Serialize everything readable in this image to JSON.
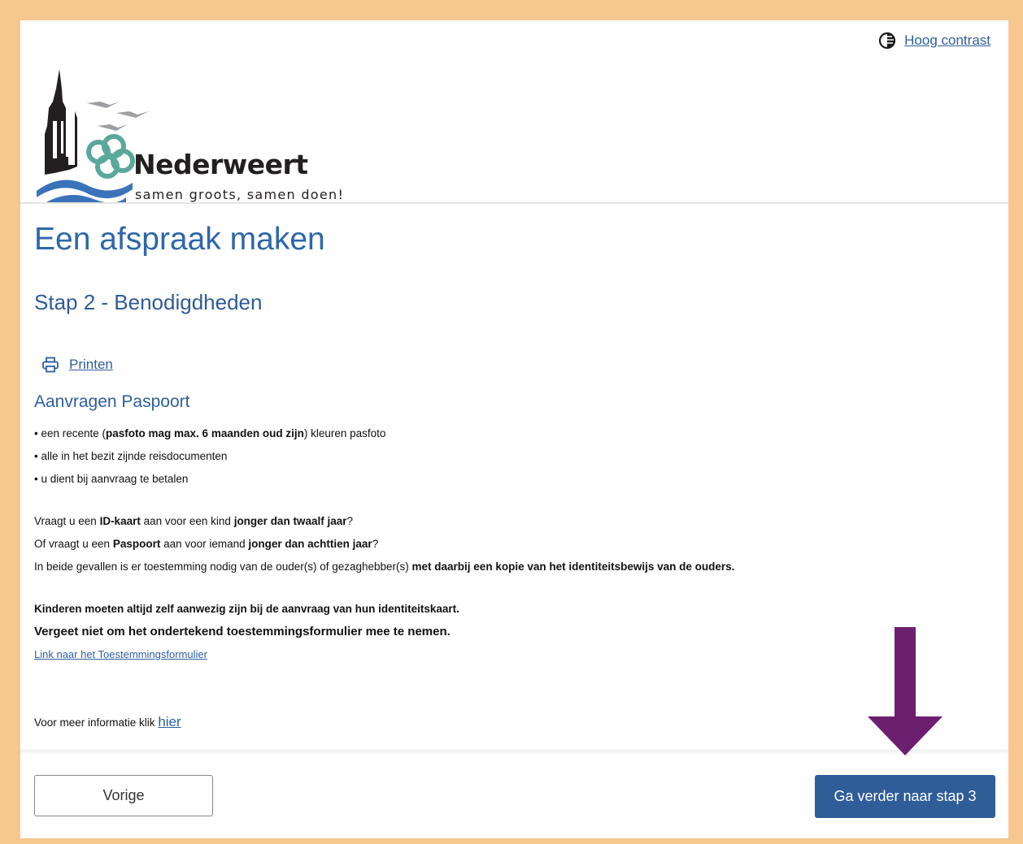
{
  "header": {
    "high_contrast_label": "Hoog contrast"
  },
  "logo": {
    "name": "Nederweert",
    "tagline": "samen groots, samen doen!"
  },
  "page": {
    "title": "Een afspraak maken",
    "step": "Stap 2 - Benodigdheden",
    "print_label": "Printen",
    "section_title": "Aanvragen Paspoort"
  },
  "requirements": {
    "item1_pre": "• een recente (",
    "item1_bold": "pasfoto mag max. 6 maanden oud zijn",
    "item1_post": ") kleuren pasfoto",
    "item2": "• alle in het bezit zijnde reisdocumenten",
    "item3": "• u dient bij aanvraag te betalen"
  },
  "consent": {
    "l1_a": "Vraagt u een ",
    "l1_b": "ID-kaart",
    "l1_c": " aan voor een kind ",
    "l1_d": "jonger dan twaalf jaar",
    "l1_e": "?",
    "l2_a": "Of vraagt u een ",
    "l2_b": "Paspoort",
    "l2_c": " aan voor iemand ",
    "l2_d": "jonger dan achttien jaar",
    "l2_e": "?",
    "l3_a": "In beide gevallen is er toestemming nodig van de ouder(s) of gezaghebber(s) ",
    "l3_b": "met daarbij een kopie van het identiteitsbewijs van de ouders."
  },
  "notes": {
    "children_a": "Kinderen moeten ",
    "children_b": "altijd zelf aanwezig zijn bij de aanvraag van hun identiteitskaart.",
    "reminder": "Vergeet niet om het ondertekend toestemmingsformulier mee te nemen.",
    "form_link": "Link naar het Toestemmingsformulier",
    "more_info": "Voor meer informatie klik ",
    "more_link": "hier"
  },
  "buttons": {
    "prev": "Vorige",
    "next": "Ga verder naar stap 3"
  },
  "colors": {
    "frame": "#f6c890",
    "brand_blue": "#2e66aa",
    "button_blue": "#2f5d98",
    "arrow_purple": "#6b1f6e"
  },
  "icons": {
    "contrast": "contrast-icon",
    "print": "printer-icon",
    "arrow": "arrow-down-icon"
  }
}
